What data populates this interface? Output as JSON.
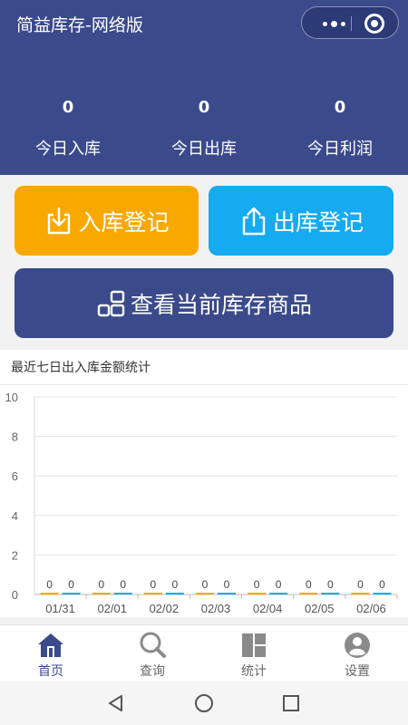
{
  "header": {
    "title": "简益库存-网络版",
    "stats": [
      {
        "value": "0",
        "label": "今日入库"
      },
      {
        "value": "0",
        "label": "今日出库"
      },
      {
        "value": "0",
        "label": "今日利润"
      }
    ]
  },
  "actions": {
    "stock_in": "入库登记",
    "stock_out": "出库登记",
    "view_stock": "查看当前库存商品"
  },
  "chart": {
    "title": "最近七日出入库金额统计"
  },
  "chart_data": {
    "type": "bar",
    "categories": [
      "01/31",
      "02/01",
      "02/02",
      "02/03",
      "02/04",
      "02/05",
      "02/06"
    ],
    "series": [
      {
        "values": [
          0,
          0,
          0,
          0,
          0,
          0,
          0
        ],
        "color": "#f9a800"
      },
      {
        "values": [
          0,
          0,
          0,
          0,
          0,
          0,
          0
        ],
        "color": "#16aaf0"
      }
    ],
    "y_ticks": [
      0,
      2,
      4,
      6,
      8,
      10
    ],
    "ylim": [
      0,
      10
    ],
    "grid": true
  },
  "tabs": [
    {
      "label": "首页",
      "icon": "home-icon",
      "active": true
    },
    {
      "label": "查询",
      "icon": "search-icon",
      "active": false
    },
    {
      "label": "统计",
      "icon": "stats-icon",
      "active": false
    },
    {
      "label": "设置",
      "icon": "user-icon",
      "active": false
    }
  ],
  "colors": {
    "primary": "#3a4a8b",
    "stock_in": "#f9a800",
    "stock_out": "#16aaf0"
  }
}
